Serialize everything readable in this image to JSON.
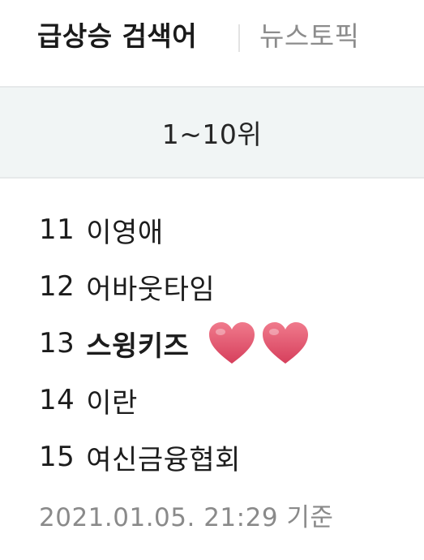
{
  "tabs": {
    "active_label": "급상승 검색어",
    "inactive_label": "뉴스토픽"
  },
  "range_label": "1~10위",
  "rankings": [
    {
      "rank": "11",
      "keyword": "이영애"
    },
    {
      "rank": "12",
      "keyword": "어바웃타임"
    },
    {
      "rank": "13",
      "keyword": "스윙키즈"
    },
    {
      "rank": "14",
      "keyword": "이란"
    },
    {
      "rank": "15",
      "keyword": "여신금융협회"
    }
  ],
  "highlight": {
    "row_index": 2,
    "icon": "heart-icon",
    "count": 2,
    "color": "#e2536b"
  },
  "timestamp": "2021.01.05. 21:29 기준"
}
